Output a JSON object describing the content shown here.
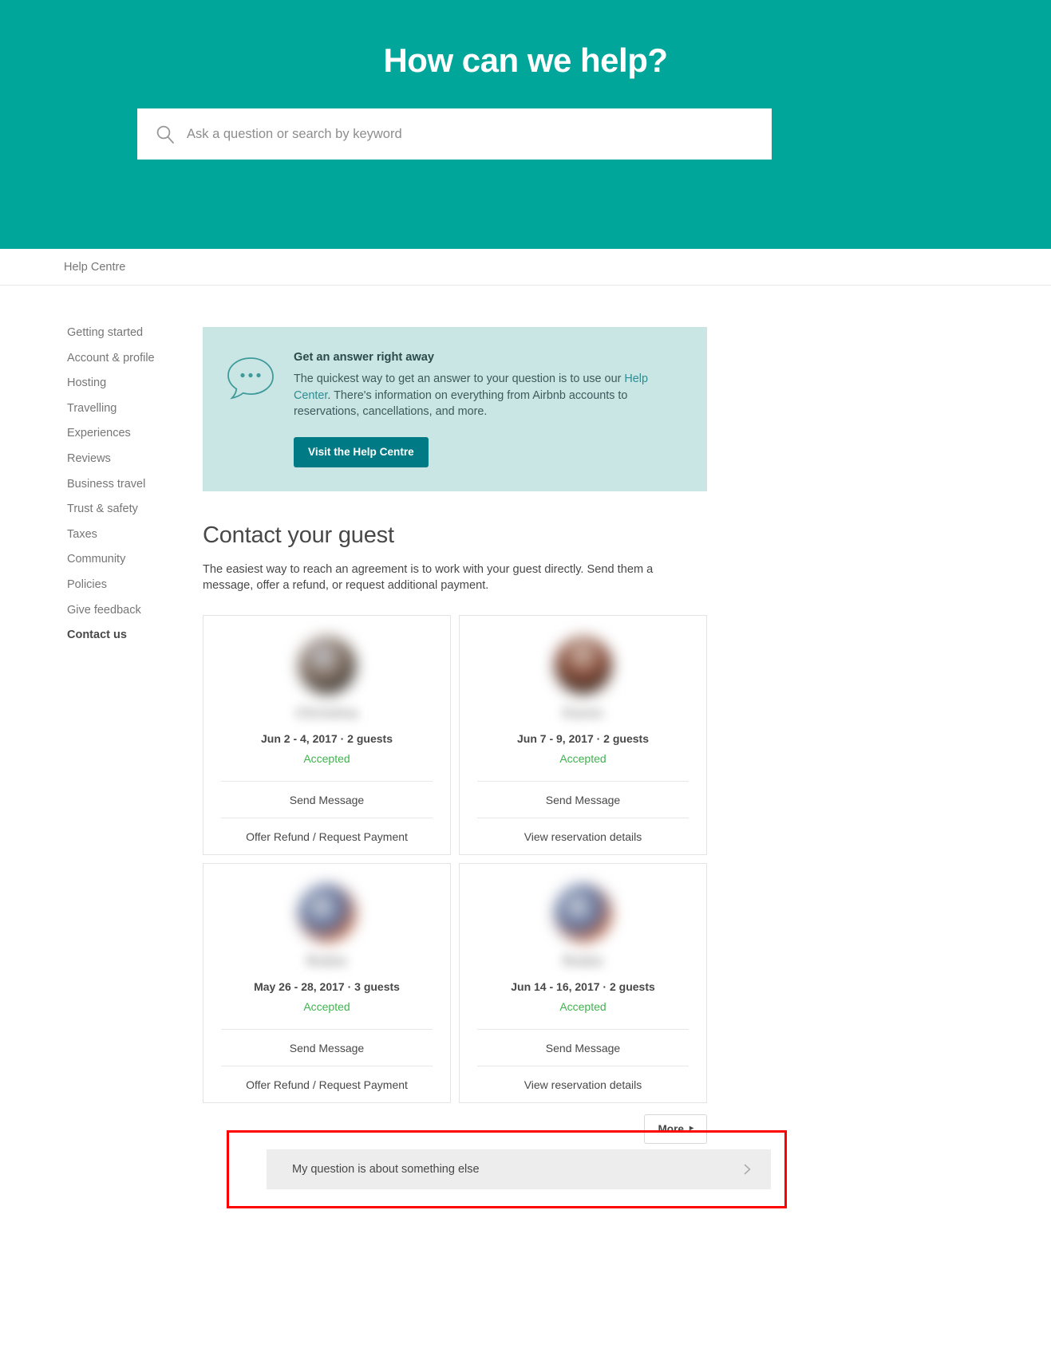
{
  "colors": {
    "hero_bg": "#00a699",
    "banner_bg": "#c9e5e4",
    "button_teal": "#007a84",
    "link_teal": "#2e8d92",
    "accepted_green": "#3fb34f",
    "highlight_red": "#ff0000",
    "row_gray": "#ededed"
  },
  "hero": {
    "title": "How can we help?",
    "search_placeholder": "Ask a question or search by keyword",
    "search_value": "",
    "search_icon": "search-icon"
  },
  "breadcrumb": {
    "items": [
      "Help Centre"
    ]
  },
  "sidebar": {
    "items": [
      {
        "label": "Getting started",
        "active": false
      },
      {
        "label": "Account & profile",
        "active": false
      },
      {
        "label": "Hosting",
        "active": false
      },
      {
        "label": "Travelling",
        "active": false
      },
      {
        "label": "Experiences",
        "active": false
      },
      {
        "label": "Reviews",
        "active": false
      },
      {
        "label": "Business travel",
        "active": false
      },
      {
        "label": "Trust & safety",
        "active": false
      },
      {
        "label": "Taxes",
        "active": false
      },
      {
        "label": "Community",
        "active": false
      },
      {
        "label": "Policies",
        "active": false
      },
      {
        "label": "Give feedback",
        "active": false
      },
      {
        "label": "Contact us",
        "active": true
      }
    ]
  },
  "info_banner": {
    "icon": "speech-bubble-icon",
    "title": "Get an answer right away",
    "text_before": "The quickest way to get an answer to your question is to use our ",
    "link_text": "Help Center",
    "text_after": ". There's information on everything from Airbnb accounts to reservations, cancellations, and more.",
    "button_label": "Visit the Help Centre"
  },
  "main": {
    "title": "Contact your guest",
    "description": "The easiest way to reach an agreement is to work with your guest directly. Send them a message, offer a refund, or request additional payment.",
    "more_label": "More",
    "more_caret": "▸"
  },
  "reservations": [
    {
      "guest_name": "Christina",
      "dates": "Jun 2 - 4, 2017 · 2 guests",
      "status": "Accepted",
      "actions": [
        "Send Message",
        "Offer Refund / Request Payment"
      ]
    },
    {
      "guest_name": "Karen",
      "dates": "Jun 7 - 9, 2017 · 2 guests",
      "status": "Accepted",
      "actions": [
        "Send Message",
        "View reservation details"
      ]
    },
    {
      "guest_name": "Robin",
      "dates": "May 26 - 28, 2017 · 3 guests",
      "status": "Accepted",
      "actions": [
        "Send Message",
        "Offer Refund / Request Payment"
      ]
    },
    {
      "guest_name": "Robin",
      "dates": "Jun 14 - 16, 2017 · 2 guests",
      "status": "Accepted",
      "actions": [
        "Send Message",
        "View reservation details"
      ]
    }
  ],
  "something_else_row": {
    "label": "My question is about something else",
    "chevron_icon": "chevron-right-icon"
  }
}
